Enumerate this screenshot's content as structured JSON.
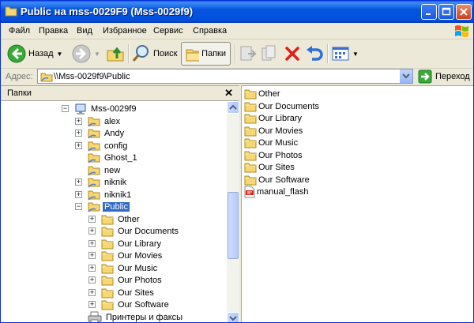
{
  "window": {
    "title": "Public на mss-0029F9 (Mss-0029f9)"
  },
  "menu": [
    {
      "label": "Файл"
    },
    {
      "label": "Правка"
    },
    {
      "label": "Вид"
    },
    {
      "label": "Избранное"
    },
    {
      "label": "Сервис"
    },
    {
      "label": "Справка"
    }
  ],
  "toolbar": {
    "back_label": "Назад",
    "search_label": "Поиск",
    "folders_label": "Папки"
  },
  "address": {
    "label": "Адрес:",
    "value": "\\\\Mss-0029f9\\Public",
    "go_label": "Переход"
  },
  "folders_pane": {
    "title": "Папки",
    "tree": [
      {
        "label": "Mss-0029f9",
        "expander": "−",
        "icon": "computer-icon"
      },
      {
        "label": "alex",
        "expander": "+",
        "icon": "shared-folder-icon"
      },
      {
        "label": "Andy",
        "expander": "+",
        "icon": "shared-folder-icon"
      },
      {
        "label": "config",
        "expander": "+",
        "icon": "shared-folder-icon"
      },
      {
        "label": "Ghost_1",
        "expander": "",
        "icon": "shared-folder-icon"
      },
      {
        "label": "new",
        "expander": "",
        "icon": "shared-folder-icon"
      },
      {
        "label": "niknik",
        "expander": "+",
        "icon": "shared-folder-icon"
      },
      {
        "label": "niknik1",
        "expander": "+",
        "icon": "shared-folder-icon"
      },
      {
        "label": "Public",
        "expander": "−",
        "icon": "shared-folder-icon",
        "selected": true
      },
      {
        "label": "Other",
        "expander": "+",
        "icon": "folder-icon"
      },
      {
        "label": "Our Documents",
        "expander": "+",
        "icon": "folder-icon"
      },
      {
        "label": "Our Library",
        "expander": "+",
        "icon": "folder-icon"
      },
      {
        "label": "Our Movies",
        "expander": "+",
        "icon": "folder-icon"
      },
      {
        "label": "Our Music",
        "expander": "+",
        "icon": "folder-icon"
      },
      {
        "label": "Our Photos",
        "expander": "+",
        "icon": "folder-icon"
      },
      {
        "label": "Our Sites",
        "expander": "+",
        "icon": "folder-icon"
      },
      {
        "label": "Our Software",
        "expander": "+",
        "icon": "folder-icon"
      },
      {
        "label": "Принтеры и факсы",
        "expander": "",
        "icon": "printers-icon"
      }
    ]
  },
  "content": {
    "items": [
      {
        "label": "Other",
        "icon": "folder-icon"
      },
      {
        "label": "Our Documents",
        "icon": "folder-icon"
      },
      {
        "label": "Our Library",
        "icon": "folder-icon"
      },
      {
        "label": "Our Movies",
        "icon": "folder-icon"
      },
      {
        "label": "Our Music",
        "icon": "folder-icon"
      },
      {
        "label": "Our Photos",
        "icon": "folder-icon"
      },
      {
        "label": "Our Sites",
        "icon": "folder-icon"
      },
      {
        "label": "Our Software",
        "icon": "folder-icon"
      },
      {
        "label": "manual_flash",
        "icon": "pdf-file-icon"
      }
    ]
  },
  "colors": {
    "title_bar": "#0454e0",
    "selection": "#316ac5",
    "folder": "#f5d774"
  }
}
